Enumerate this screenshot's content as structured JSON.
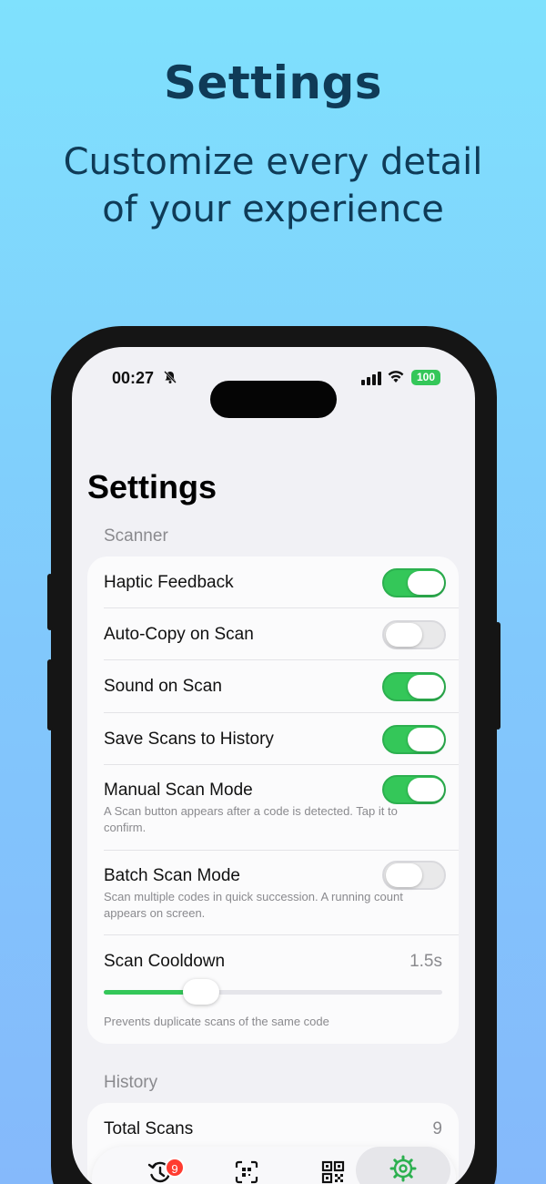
{
  "promo": {
    "title": "Settings",
    "subtitle_line1": "Customize every detail",
    "subtitle_line2": "of your experience"
  },
  "status_bar": {
    "time": "00:27",
    "battery": "100",
    "icons": [
      "bell-slash-icon",
      "cellular-signal-icon",
      "wifi-icon",
      "battery-icon"
    ]
  },
  "page": {
    "title": "Settings"
  },
  "sections": {
    "scanner": {
      "header": "Scanner",
      "items": [
        {
          "label": "Haptic Feedback",
          "enabled": true
        },
        {
          "label": "Auto-Copy on Scan",
          "enabled": false
        },
        {
          "label": "Sound on Scan",
          "enabled": true
        },
        {
          "label": "Save Scans to History",
          "enabled": true
        },
        {
          "label": "Manual Scan Mode",
          "enabled": true,
          "description": "A Scan button appears after a code is detected. Tap it to confirm."
        },
        {
          "label": "Batch Scan Mode",
          "enabled": false,
          "description": "Scan multiple codes in quick succession. A running count appears on screen."
        }
      ],
      "cooldown": {
        "label": "Scan Cooldown",
        "value": "1.5s",
        "slider_fraction": 0.25,
        "description": "Prevents duplicate scans of the same code"
      }
    },
    "history": {
      "header": "History",
      "total_scans_label": "Total Scans",
      "total_scans_value": "9"
    }
  },
  "tab_bar": {
    "tabs": [
      {
        "icon": "history-clock-icon",
        "badge": "9"
      },
      {
        "icon": "scan-qr-icon"
      },
      {
        "icon": "qr-code-icon"
      },
      {
        "icon": "gear-icon",
        "active": true
      }
    ]
  },
  "colors": {
    "accent_green": "#34C759",
    "heading_navy": "#0F3B57",
    "badge_red": "#FF3B30"
  }
}
